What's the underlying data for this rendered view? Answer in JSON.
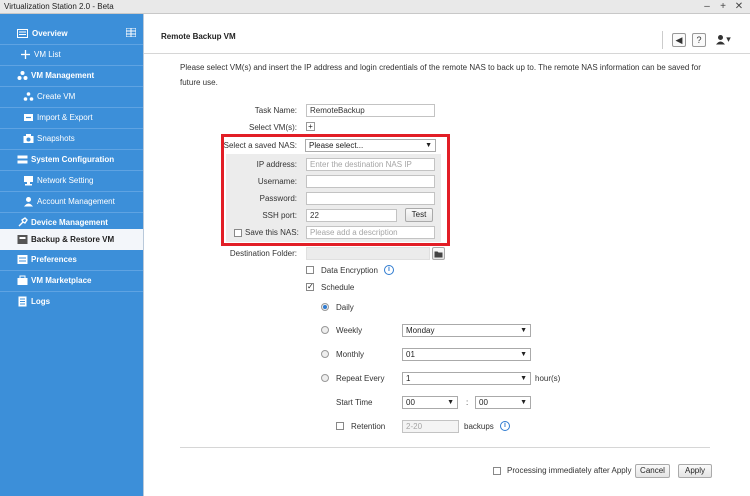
{
  "window": {
    "title": "Virtualization Station 2.0 - Beta",
    "controls": [
      "–",
      "+",
      "✕"
    ]
  },
  "sidebar": {
    "items": [
      {
        "label": "Overview",
        "icon": "overview-icon",
        "group": true
      },
      {
        "label": "VM List",
        "icon": "plus-icon",
        "group": false
      },
      {
        "label": "VM Management",
        "icon": "vm-management-icon",
        "group": true
      },
      {
        "label": "Create VM",
        "icon": "create-vm-icon",
        "group": false
      },
      {
        "label": "Import & Export",
        "icon": "import-export-icon",
        "group": false
      },
      {
        "label": "Snapshots",
        "icon": "snapshots-icon",
        "group": false
      },
      {
        "label": "System Configuration",
        "icon": "system-config-icon",
        "group": true
      },
      {
        "label": "Network Setting",
        "icon": "network-icon",
        "group": false
      },
      {
        "label": "Account Management",
        "icon": "account-icon",
        "group": false
      },
      {
        "label": "Device Management",
        "icon": "device-icon",
        "group": true
      },
      {
        "label": "Backup & Restore VM",
        "icon": "backup-icon",
        "group": true,
        "active": true
      },
      {
        "label": "Preferences",
        "icon": "preferences-icon",
        "group": true
      },
      {
        "label": "VM Marketplace",
        "icon": "marketplace-icon",
        "group": true
      },
      {
        "label": "Logs",
        "icon": "logs-icon",
        "group": true
      }
    ]
  },
  "header": {
    "title": "Remote Backup VM",
    "buttons": {
      "speaker": "◀",
      "help": "?",
      "user": "▾"
    }
  },
  "intro": "Please select VM(s) and insert the IP address and login credentials of the remote NAS to back up to. The remote NAS information can be saved for future use.",
  "form": {
    "task_name": {
      "label": "Task Name:",
      "value": "RemoteBackup"
    },
    "select_vms": {
      "label": "Select VM(s):"
    },
    "saved_nas": {
      "label": "Select a saved NAS:",
      "value": "Please select..."
    },
    "ip_address": {
      "label": "IP address:",
      "placeholder": "Enter the destination NAS IP"
    },
    "username": {
      "label": "Username:",
      "value": ""
    },
    "password": {
      "label": "Password:",
      "value": ""
    },
    "ssh_port": {
      "label": "SSH port:",
      "value": "22",
      "test_label": "Test"
    },
    "save_nas": {
      "label": "Save this NAS:",
      "placeholder": "Please add a description",
      "checked": false
    },
    "destination": {
      "label": "Destination Folder:",
      "value": ""
    },
    "data_encryption": {
      "label": "Data Encryption",
      "checked": false
    },
    "schedule": {
      "label": "Schedule",
      "checked": true,
      "daily": {
        "label": "Daily",
        "selected": true
      },
      "weekly": {
        "label": "Weekly",
        "value": "Monday"
      },
      "monthly": {
        "label": "Monthly",
        "value": "01"
      },
      "repeat": {
        "label": "Repeat Every",
        "value": "1",
        "unit": "hour(s)"
      },
      "start_time": {
        "label": "Start Time",
        "hour": "00",
        "sep": ":",
        "minute": "00"
      },
      "retention": {
        "label": "Retention",
        "placeholder": "2-20",
        "unit": "backups",
        "checked": false
      }
    }
  },
  "footer": {
    "processing_label": "Processing immediately after Apply",
    "cancel": "Cancel",
    "apply": "Apply"
  },
  "colors": {
    "sidebar": "#3c8fd9",
    "highlight": "#e21e26",
    "accent": "#2f7bd0"
  }
}
